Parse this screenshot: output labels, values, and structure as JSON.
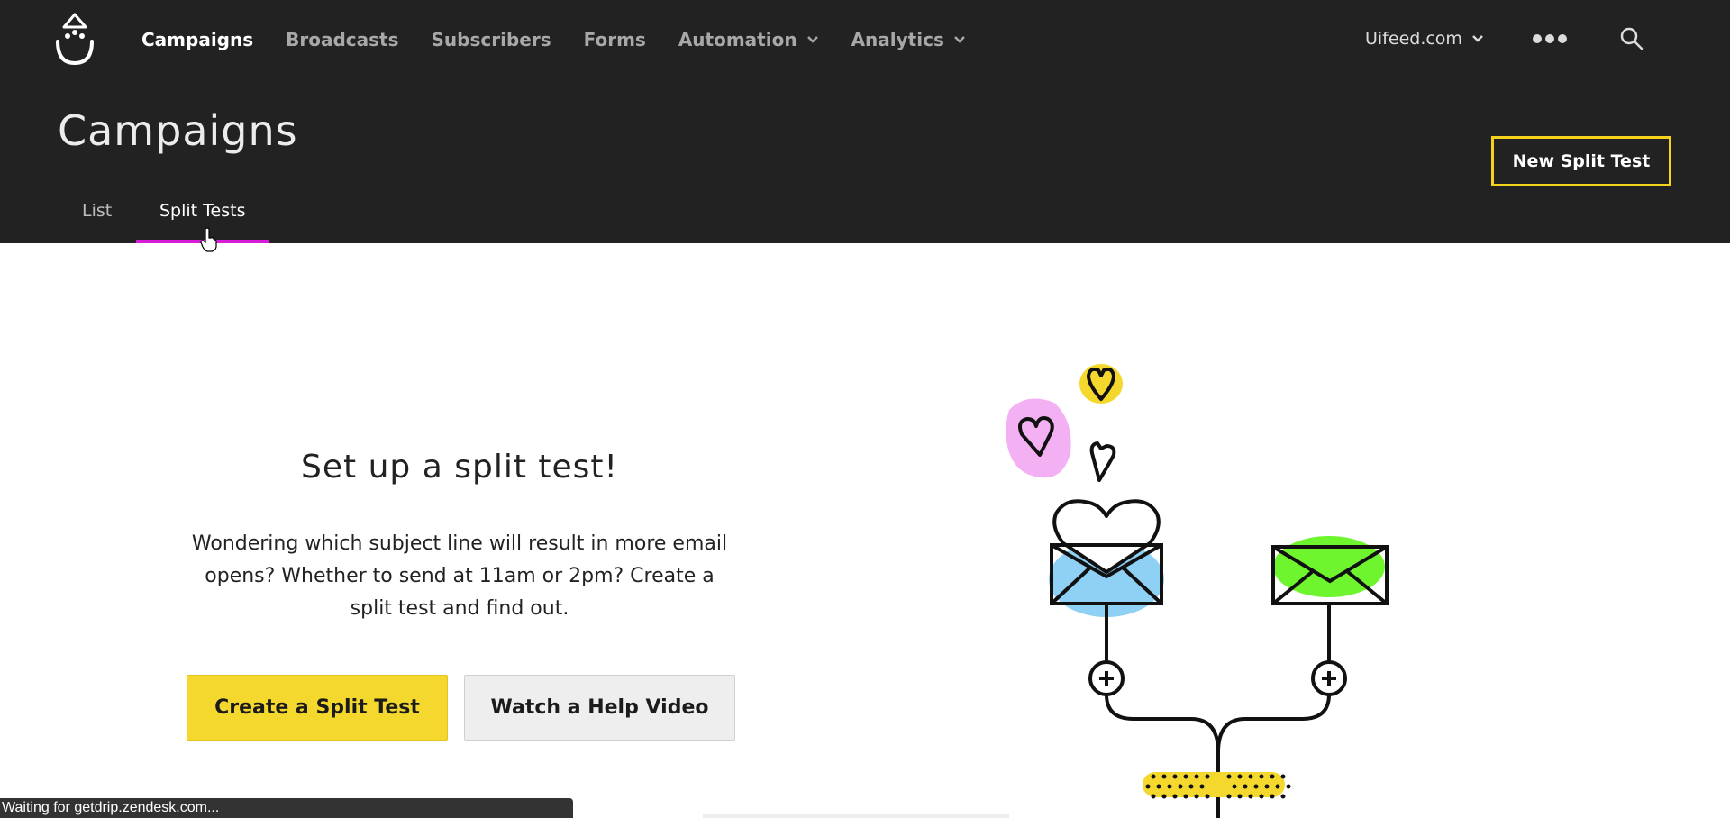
{
  "nav": {
    "items": [
      {
        "label": "Campaigns",
        "active": true,
        "dropdown": false
      },
      {
        "label": "Broadcasts",
        "active": false,
        "dropdown": false
      },
      {
        "label": "Subscribers",
        "active": false,
        "dropdown": false
      },
      {
        "label": "Forms",
        "active": false,
        "dropdown": false
      },
      {
        "label": "Automation",
        "active": false,
        "dropdown": true
      },
      {
        "label": "Analytics",
        "active": false,
        "dropdown": true
      }
    ],
    "account": "Uifeed.com",
    "more_icon": "more-dots-icon",
    "search_icon": "search-icon"
  },
  "page": {
    "title": "Campaigns",
    "tabs": [
      {
        "label": "List",
        "active": false
      },
      {
        "label": "Split Tests",
        "active": true
      }
    ],
    "new_split_label": "New Split Test"
  },
  "empty_state": {
    "heading": "Set up a split test!",
    "description": "Wondering which subject line will result in more email opens? Whether to send at 11am or 2pm? Create a split test and find out.",
    "create_button": "Create a Split Test",
    "video_button": "Watch a Help Video"
  },
  "status_bar": "Waiting for getdrip.zendesk.com...",
  "colors": {
    "header_bg": "#222222",
    "accent_yellow": "#f5d82e",
    "tab_underline": "#d81bd8",
    "envelope_blue": "#8fd0f5",
    "envelope_green": "#6ef52e",
    "heart_pink": "#f3b0f2"
  }
}
